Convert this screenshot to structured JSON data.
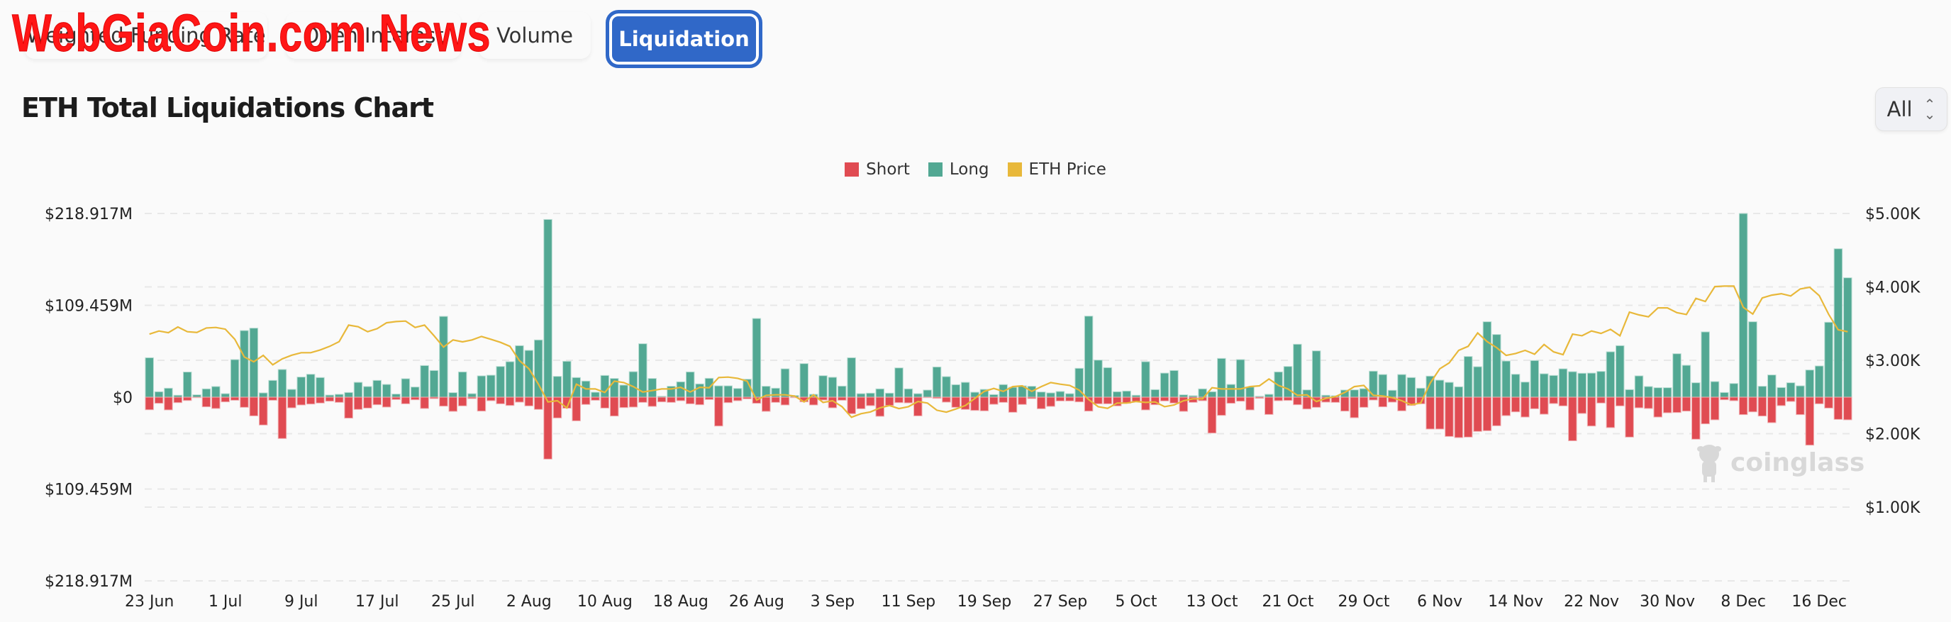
{
  "tabs": [
    {
      "label": "Weighted Funding Rate"
    },
    {
      "label": "Open Interest"
    },
    {
      "label": "Volume"
    },
    {
      "label": "Liquidation",
      "active": true
    }
  ],
  "watermark": "WebGiaCoin.com News",
  "title": "ETH Total Liquidations Chart",
  "range_select": {
    "value": "All",
    "icon": "chevron-up-down-icon"
  },
  "brand_watermark": "coinglass",
  "colors": {
    "short": "#e04b52",
    "long": "#52a893",
    "price": "#e8b83a",
    "accent": "#3068c8"
  },
  "chart_data": {
    "type": "bar",
    "title": "ETH Total Liquidations Chart",
    "legend": [
      "Short",
      "Long",
      "ETH Price"
    ],
    "legend_position": "top",
    "grid": true,
    "x_tick_labels": [
      "23 Jun",
      "1 Jul",
      "9 Jul",
      "17 Jul",
      "25 Jul",
      "2 Aug",
      "10 Aug",
      "18 Aug",
      "26 Aug",
      "3 Sep",
      "11 Sep",
      "19 Sep",
      "27 Sep",
      "5 Oct",
      "13 Oct",
      "21 Oct",
      "29 Oct",
      "6 Nov",
      "14 Nov",
      "22 Nov",
      "30 Nov",
      "8 Dec",
      "16 Dec"
    ],
    "y_left_ticks": [
      "$218.917M",
      "$109.459M",
      "$0",
      "$109.459M",
      "$218.917M"
    ],
    "y_left_range_musd": [
      -218.917,
      218.917
    ],
    "y_right_ticks": [
      "$5.00K",
      "$4.00K",
      "$3.00K",
      "$2.00K",
      "$1.00K"
    ],
    "y_right_range_usd": [
      0,
      5000
    ],
    "x": [
      "23 Jun",
      "24 Jun",
      "25 Jun",
      "26 Jun",
      "27 Jun",
      "28 Jun",
      "29 Jun",
      "30 Jun",
      "1 Jul",
      "2 Jul",
      "3 Jul",
      "4 Jul",
      "5 Jul",
      "6 Jul",
      "7 Jul",
      "8 Jul",
      "9 Jul",
      "10 Jul",
      "11 Jul",
      "12 Jul",
      "13 Jul",
      "14 Jul",
      "15 Jul",
      "16 Jul",
      "17 Jul",
      "18 Jul",
      "19 Jul",
      "20 Jul",
      "21 Jul",
      "22 Jul",
      "23 Jul",
      "24 Jul",
      "25 Jul",
      "26 Jul",
      "27 Jul",
      "28 Jul",
      "29 Jul",
      "30 Jul",
      "31 Jul",
      "1 Aug",
      "2 Aug",
      "3 Aug",
      "4 Aug",
      "5 Aug",
      "6 Aug",
      "7 Aug",
      "8 Aug",
      "9 Aug",
      "10 Aug",
      "11 Aug",
      "12 Aug",
      "13 Aug",
      "14 Aug",
      "15 Aug",
      "16 Aug",
      "17 Aug",
      "18 Aug",
      "19 Aug",
      "20 Aug",
      "21 Aug",
      "22 Aug",
      "23 Aug",
      "24 Aug",
      "25 Aug",
      "26 Aug",
      "27 Aug",
      "28 Aug",
      "29 Aug",
      "30 Aug",
      "31 Aug",
      "1 Sep",
      "2 Sep",
      "3 Sep",
      "4 Sep",
      "5 Sep",
      "6 Sep",
      "7 Sep",
      "8 Sep",
      "9 Sep",
      "10 Sep",
      "11 Sep",
      "12 Sep",
      "13 Sep",
      "14 Sep",
      "15 Sep",
      "16 Sep",
      "17 Sep",
      "18 Sep",
      "19 Sep",
      "20 Sep",
      "21 Sep",
      "22 Sep",
      "23 Sep",
      "24 Sep",
      "25 Sep",
      "26 Sep",
      "27 Sep",
      "28 Sep",
      "29 Sep",
      "30 Sep",
      "1 Oct",
      "2 Oct",
      "3 Oct",
      "4 Oct",
      "5 Oct",
      "6 Oct",
      "7 Oct",
      "8 Oct",
      "9 Oct",
      "10 Oct",
      "11 Oct",
      "12 Oct",
      "13 Oct",
      "14 Oct",
      "15 Oct",
      "16 Oct",
      "17 Oct",
      "18 Oct",
      "19 Oct",
      "20 Oct",
      "21 Oct",
      "22 Oct",
      "23 Oct",
      "24 Oct",
      "25 Oct",
      "26 Oct",
      "27 Oct",
      "28 Oct",
      "29 Oct",
      "30 Oct",
      "31 Oct",
      "1 Nov",
      "2 Nov",
      "3 Nov",
      "4 Nov",
      "5 Nov",
      "6 Nov",
      "7 Nov",
      "8 Nov",
      "9 Nov",
      "10 Nov",
      "11 Nov",
      "12 Nov",
      "13 Nov",
      "14 Nov",
      "15 Nov",
      "16 Nov",
      "17 Nov",
      "18 Nov",
      "19 Nov",
      "20 Nov",
      "21 Nov",
      "22 Nov",
      "23 Nov",
      "24 Nov",
      "25 Nov",
      "26 Nov",
      "27 Nov",
      "28 Nov",
      "29 Nov",
      "30 Nov",
      "1 Dec",
      "2 Dec",
      "3 Dec",
      "4 Dec",
      "5 Dec",
      "6 Dec",
      "7 Dec",
      "8 Dec",
      "9 Dec",
      "10 Dec",
      "11 Dec",
      "12 Dec",
      "13 Dec",
      "14 Dec",
      "15 Dec",
      "16 Dec",
      "17 Dec",
      "18 Dec",
      "19 Dec"
    ],
    "series": [
      {
        "name": "Long",
        "unit": "USD millions",
        "values": [
          47,
          6.5,
          10.7,
          2.3,
          30,
          2.8,
          9.9,
          12.7,
          4.2,
          44.8,
          79.4,
          82.3,
          5.1,
          20,
          33,
          9.3,
          24,
          27.3,
          23.4,
          2.5,
          3.4,
          5.6,
          17.7,
          12.7,
          20,
          15.2,
          3.7,
          22,
          12.1,
          37.7,
          31.8,
          96.3,
          5.4,
          30.1,
          4.2,
          25.4,
          26.2,
          36.6,
          42.3,
          61.4,
          55.8,
          68.2,
          211.8,
          24.8,
          42.8,
          23.4,
          19.2,
          5.9,
          25.9,
          22.3,
          14.4,
          30.4,
          63.7,
          22.3,
          1.1,
          13,
          18.3,
          30.1,
          15.8,
          22.5,
          13.5,
          13.5,
          10.4,
          21.4,
          93.8,
          13,
          10.7,
          33.8,
          2,
          40,
          3.4,
          25.6,
          23.7,
          13.2,
          47,
          4.2,
          4.8,
          9.9,
          4.8,
          34.9,
          9.9,
          4.2,
          8.5,
          36,
          24.5,
          14.9,
          17.7,
          5.9,
          9.3,
          3.1,
          15,
          11.8,
          13.5,
          13,
          6.2,
          5.1,
          6.8,
          4.2,
          34.4,
          96.6,
          44.2,
          35.2,
          6.5,
          7.3,
          2.3,
          42.3,
          9,
          28.7,
          31.8,
          2.8,
          1.7,
          9.9,
          6.5,
          46.2,
          15.2,
          44.8,
          12.1,
          1.1,
          3.4,
          30.1,
          36.6,
          63.1,
          8.7,
          55.2,
          2.3,
          1.7,
          8.5,
          8.7,
          10.1,
          31,
          27,
          8.2,
          27,
          23.4,
          10.7,
          25.1,
          20.3,
          17.7,
          12.4,
          48.5,
          36.3,
          89.9,
          74.7,
          43.1,
          27.3,
          18,
          43.7,
          27.9,
          25.9,
          33.8,
          30.4,
          28.5,
          28.7,
          30.7,
          54.1,
          61.4,
          9,
          25.4,
          12.7,
          11.3,
          11.3,
          51.8,
          38,
          17.2,
          77.8,
          18.6,
          5.6,
          16.3,
          218.9,
          89.9,
          13,
          26.5,
          11.5,
          17.2,
          13.5,
          32.4,
          37.2,
          89.3,
          176.9,
          142.3
        ]
      },
      {
        "name": "Short",
        "unit": "USD millions",
        "values": [
          15,
          7.3,
          15.2,
          6.5,
          4,
          0.6,
          11.5,
          13.5,
          5.6,
          3.7,
          12.1,
          22.3,
          33.2,
          3.7,
          49.3,
          12.7,
          9.3,
          8.2,
          7,
          4.8,
          6.2,
          25,
          14.6,
          13,
          9,
          11.8,
          2.8,
          7.9,
          3.1,
          13.5,
          1.7,
          10.7,
          16.9,
          10.4,
          1.7,
          16.6,
          4.2,
          7.9,
          9.9,
          5.9,
          10.4,
          14.6,
          73.8,
          24.8,
          13.2,
          28.2,
          8.7,
          3.7,
          13,
          22.5,
          12.4,
          11.8,
          6.2,
          11,
          5.6,
          6.2,
          4.2,
          7.9,
          9,
          2.8,
          34.4,
          6.5,
          4.2,
          2,
          7.3,
          16.9,
          6.2,
          9.3,
          0.6,
          5.6,
          9.3,
          3.4,
          12.7,
          3.7,
          19.7,
          13.8,
          10.1,
          22.8,
          9.9,
          6.5,
          6.8,
          22.3,
          0.6,
          1.4,
          5.9,
          12.1,
          14.6,
          15.8,
          16.3,
          8.5,
          6.2,
          18,
          8.7,
          1.7,
          13.8,
          11,
          4.5,
          4.5,
          5.6,
          16.6,
          7.9,
          7.9,
          10.4,
          7.3,
          5.1,
          15.2,
          9,
          4.5,
          7,
          16.9,
          6.2,
          4.2,
          42.8,
          21.7,
          7.3,
          4.8,
          15.2,
          1.4,
          20.6,
          4.2,
          3.9,
          9,
          14.1,
          12.1,
          5.9,
          6.2,
          16.6,
          24.5,
          12.1,
          3.4,
          11.5,
          5.9,
          16.3,
          9.9,
          7.9,
          38,
          38,
          46.8,
          48.2,
          47.6,
          40.8,
          40,
          34.1,
          22,
          17.5,
          23.7,
          13.8,
          20.3,
          7.6,
          10.4,
          52,
          19.4,
          34.4,
          7,
          36.3,
          10.4,
          47.6,
          12.7,
          13.5,
          23.7,
          18.6,
          18.3,
          16.6,
          50.1,
          31.8,
          27,
          3.1,
          4.2,
          20.8,
          17.5,
          22.5,
          30.4,
          10.1,
          5.1,
          20.8,
          57.2,
          7.9,
          13,
          26.5,
          27
        ]
      },
      {
        "name": "ETH Price",
        "unit": "USD",
        "axis": "right",
        "type": "line",
        "values": [
          3357,
          3399,
          3376,
          3454,
          3389,
          3380,
          3441,
          3447,
          3424,
          3286,
          3045,
          2980,
          3067,
          2939,
          3019,
          3070,
          3103,
          3103,
          3141,
          3190,
          3254,
          3479,
          3457,
          3389,
          3431,
          3511,
          3528,
          3534,
          3447,
          3479,
          3334,
          3180,
          3277,
          3251,
          3277,
          3325,
          3286,
          3244,
          3190,
          2996,
          2884,
          2674,
          2433,
          2449,
          2352,
          2674,
          2610,
          2610,
          2562,
          2716,
          2697,
          2642,
          2568,
          2587,
          2610,
          2610,
          2632,
          2568,
          2632,
          2626,
          2765,
          2771,
          2755,
          2716,
          2459,
          2523,
          2529,
          2529,
          2513,
          2433,
          2529,
          2426,
          2449,
          2368,
          2224,
          2272,
          2297,
          2352,
          2384,
          2342,
          2368,
          2439,
          2417,
          2320,
          2294,
          2336,
          2384,
          2481,
          2577,
          2616,
          2577,
          2642,
          2652,
          2577,
          2642,
          2697,
          2674,
          2658,
          2594,
          2465,
          2368,
          2346,
          2417,
          2417,
          2439,
          2426,
          2433,
          2368,
          2391,
          2449,
          2475,
          2475,
          2626,
          2610,
          2610,
          2610,
          2642,
          2652,
          2745,
          2658,
          2610,
          2523,
          2529,
          2439,
          2481,
          2504,
          2562,
          2642,
          2658,
          2523,
          2513,
          2491,
          2449,
          2394,
          2417,
          2690,
          2884,
          2964,
          3135,
          3190,
          3373,
          3254,
          3173,
          3067,
          3093,
          3135,
          3083,
          3215,
          3115,
          3077,
          3357,
          3334,
          3399,
          3366,
          3421,
          3334,
          3656,
          3618,
          3592,
          3714,
          3714,
          3649,
          3624,
          3843,
          3801,
          4004,
          4011,
          4011,
          3721,
          3630,
          3849,
          3888,
          3907,
          3876,
          3972,
          3994,
          3881,
          3624,
          3415,
          3389
        ]
      }
    ]
  }
}
